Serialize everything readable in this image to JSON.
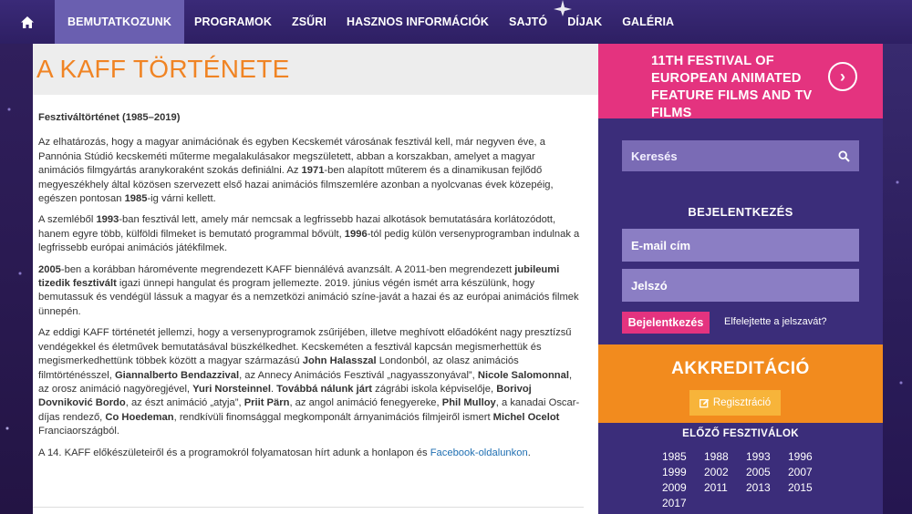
{
  "nav": {
    "items": [
      {
        "label": "BEMUTATKOZUNK",
        "active": true
      },
      {
        "label": "PROGRAMOK"
      },
      {
        "label": "ZSŰRI"
      },
      {
        "label": "HASZNOS INFORMÁCIÓK"
      },
      {
        "label": "SAJTÓ"
      },
      {
        "label": "DÍJAK"
      },
      {
        "label": "GALÉRIA"
      }
    ]
  },
  "main": {
    "title": "A KAFF TÖRTÉNETE",
    "subtitle": "Fesztiváltörténet (1985–2019)",
    "paragraphs": [
      "Az elhatározás, hogy a magyar animációnak és egyben Kecskemét városának fesztivál kell, már negyven éve, a Pannónia Stúdió kecskeméti műterme megalakulásakor megszületett, abban a korszakban, amelyet a magyar animációs filmgyártás aranykoraként szokás definiálni. Az 1971-ben alapított műterem és a dinamikusan fejlődő megyeszékhely által közösen szervezett első hazai animációs filmszemlére azonban a nyolcvanas évek közepéig, egészen pontosan 1985-ig várni kellett.",
      "A szeméből 1993-ban fesztivál lett, amely már nemcsak a legfrissebb hazai alkotások bemutatására korlátozódott, hanem egyre több, külföldi filmeket is bemutató programmal bővült, 1996-tól pedig külön versenyprogramban indulnak a legfrissebb európai animációs játékfilmek."
    ],
    "p1": {
      "a": "Az elhatározás, hogy a magyar animációnak és egyben Kecskemét városának fesztivál kell, már negyven éve, a Pannónia Stúdió kecskeméti műterme megalakulásakor megszületett, abban a korszakban, amelyet a magyar animációs filmgyártás aranykoraként szokás definiálni. Az ",
      "b1": "1971",
      "c": "-ben alapított műterem és a dinamikusan fejlődő megyeszékhely által közösen szervezett első hazai animációs filmszemlére azonban a nyolcvanas évek közepéig, egészen pontosan ",
      "b2": "1985",
      "d": "-ig várni kellett."
    },
    "p2": {
      "a": "A szemléből ",
      "b1": "1993",
      "c": "-ban fesztivál lett, amely már nemcsak a legfrissebb hazai alkotások bemutatására korlátozódott, hanem egyre több, külföldi filmeket is bemutató programmal bővült, ",
      "b2": "1996",
      "d": "-tól pedig külön versenyprogramban indulnak a legfrissebb európai animációs játékfilmek."
    },
    "p3": {
      "b1": "2005",
      "a": "-ben a korábban háromévente megrendezett KAFF biennálévá avanzsált. A 2011-ben megrendezett ",
      "b2": "jubileumi tizedik fesztivált",
      "c": " igazi ünnepi hangulat és program jellemezte. 2019. június végén ismét arra készülünk, hogy bemutassuk és vendégül lássuk a magyar és a nemzetközi animáció színe-javát a hazai és az európai animációs filmek ünnepén."
    },
    "p4": {
      "a": "Az eddigi KAFF történetét jellemzi, hogy a versenyprogramok zsűrijében, illetve meghívott előadóként nagy presztízsű vendégekkel és életművek bemutatásával büszkélkedhet. Kecskeméten a fesztivál kapcsán megismerhettük és megismerkedhettünk többek között a magyar származású ",
      "n1": "John Halasszal",
      "b": " Londonból, az olasz animációs filmtörténésszel, ",
      "n2": "Giannalberto Bendazzival",
      "c": ", az Annecy Animációs Fesztivál „nagyasszonyával”, ",
      "n3": "Nicole Salomonnal",
      "d": ", az orosz animáció nagyöregjével, ",
      "n4": "Yuri Norsteinnel",
      "e": ". ",
      "n5": "Továbbá nálunk járt",
      "f": " zágrábi iskola képviselője, ",
      "n6": "Borivoj Dovniković Bordo",
      "g": ", az észt animáció „atyja”, ",
      "n7": "Priit Pärn",
      "h": ", az angol animáció fenegyereke, ",
      "n8": "Phil Mulloy",
      "i": ", a kanadai Oscar-díjas rendező, ",
      "n9": "Co Hoedeman",
      "j": ", rendkívüli finomsággal megkomponált árnyanimációs filmjeiről ismert ",
      "n10": "Michel Ocelot",
      "k": " Franciaországból."
    },
    "p5": {
      "a": "A 14. KAFF előkészületeiről és a programokról folyamatosan hírt adunk a honlapon és ",
      "link": "Facebook-oldalunkon",
      "b": "."
    }
  },
  "sidebar": {
    "promo_text": "11TH FESTIVAL OF EUROPEAN ANIMATED FEATURE FILMS AND TV FILMS",
    "search_placeholder": "Keresés",
    "login_title": "BEJELENTKEZÉS",
    "email_placeholder": "E-mail cím",
    "password_placeholder": "Jelszó",
    "login_button": "Bejelentkezés",
    "forgot_link": "Elfelejtette a jelszavát?",
    "accreditation_title": "AKKREDITÁCIÓ",
    "registration_button": "Regisztráció",
    "previous_title": "ELŐZŐ FESZTIVÁLOK",
    "years": [
      "1985",
      "1988",
      "1993",
      "1996",
      "1999",
      "2002",
      "2005",
      "2007",
      "2009",
      "2011",
      "2013",
      "2015",
      "2017"
    ]
  },
  "colors": {
    "nav_bg": "#2e1f63",
    "nav_active": "#6a5fb0",
    "title_orange": "#f08424",
    "pink": "#e4337f",
    "sidebar_purple": "#3b2d7a",
    "accreditation_orange": "#f28b1e"
  }
}
